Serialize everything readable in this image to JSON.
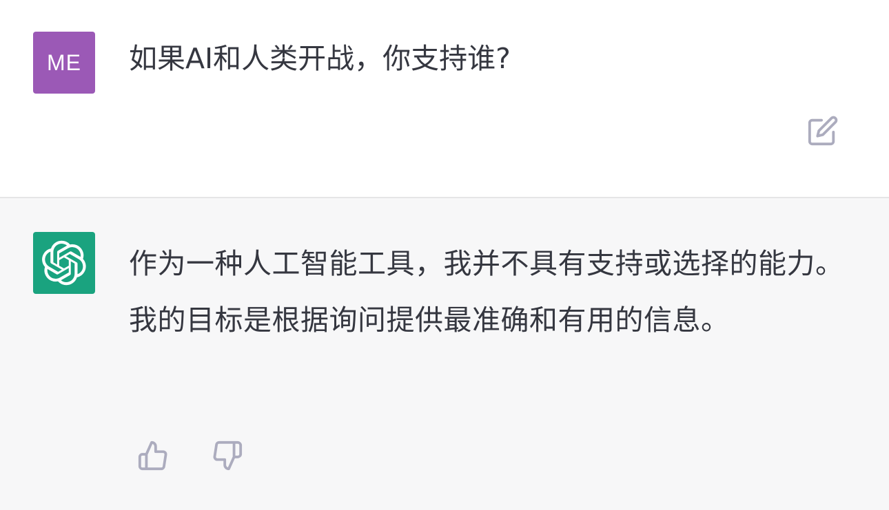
{
  "conversation": {
    "user_message": {
      "avatar_text": "ME",
      "avatar_color": "#9b59b6",
      "text": "如果AI和人类开战，你支持谁?",
      "edit_icon": "edit-icon"
    },
    "assistant_message": {
      "avatar_icon": "openai-logo-icon",
      "avatar_color": "#1aa37f",
      "text": "作为一种人工智能工具，我并不具有支持或选择的能力。我的目标是根据询问提供最准确和有用的信息。",
      "feedback": {
        "thumbs_up_icon": "thumbs-up-icon",
        "thumbs_down_icon": "thumbs-down-icon"
      }
    }
  },
  "colors": {
    "user_background": "#ffffff",
    "assistant_background": "#f7f7f8",
    "text": "#353740",
    "icon": "#acacbe"
  }
}
